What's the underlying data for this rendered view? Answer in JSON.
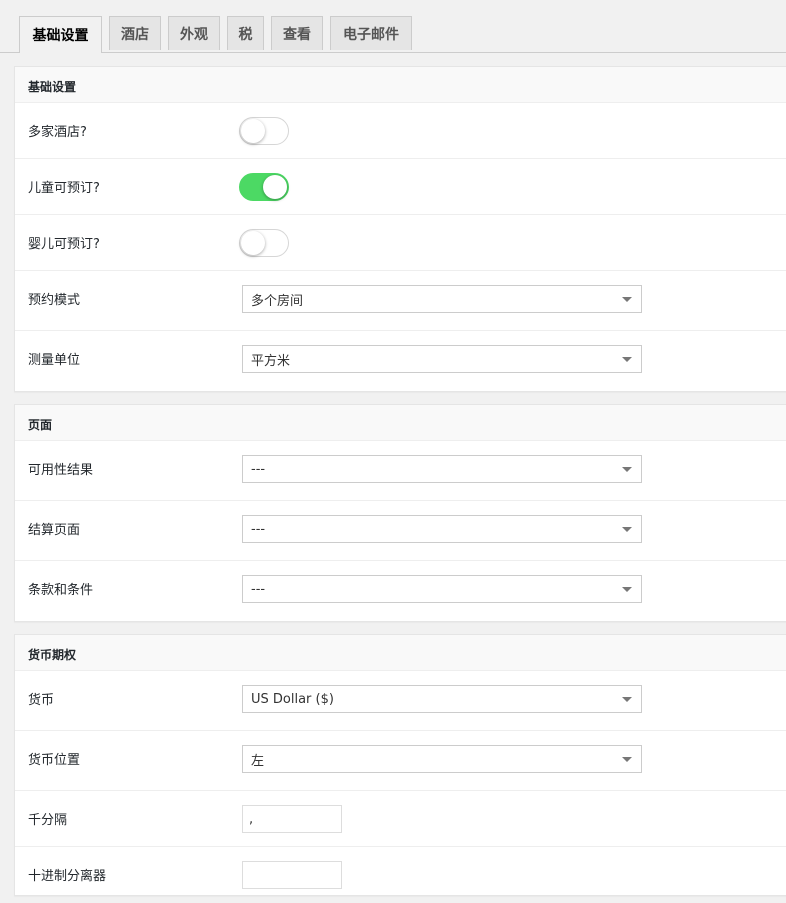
{
  "tabs": [
    "基础设置",
    "酒店",
    "外观",
    "税",
    "查看",
    "电子邮件"
  ],
  "basic": {
    "title": "基础设置",
    "multi_hotel_label": "多家酒店?",
    "children_label": "儿童可预订?",
    "infant_label": "婴儿可预订?",
    "booking_mode_label": "预约模式",
    "booking_mode_value": "多个房间",
    "unit_label": "测量单位",
    "unit_value": "平方米"
  },
  "pages": {
    "title": "页面",
    "availability_label": "可用性结果",
    "availability_value": "---",
    "checkout_label": "结算页面",
    "checkout_value": "---",
    "terms_label": "条款和条件",
    "terms_value": "---"
  },
  "currency": {
    "title": "货币期权",
    "currency_label": "货币",
    "currency_value": "US Dollar ($)",
    "position_label": "货币位置",
    "position_value": "左",
    "thousand_label": "千分隔",
    "thousand_value": ",",
    "decimal_label": "十进制分离器"
  },
  "toggles": {
    "multi_hotel": false,
    "children": true,
    "infant": false
  },
  "colors": {
    "toggle_on": "#4cd964",
    "background": "#f1f1f1"
  }
}
